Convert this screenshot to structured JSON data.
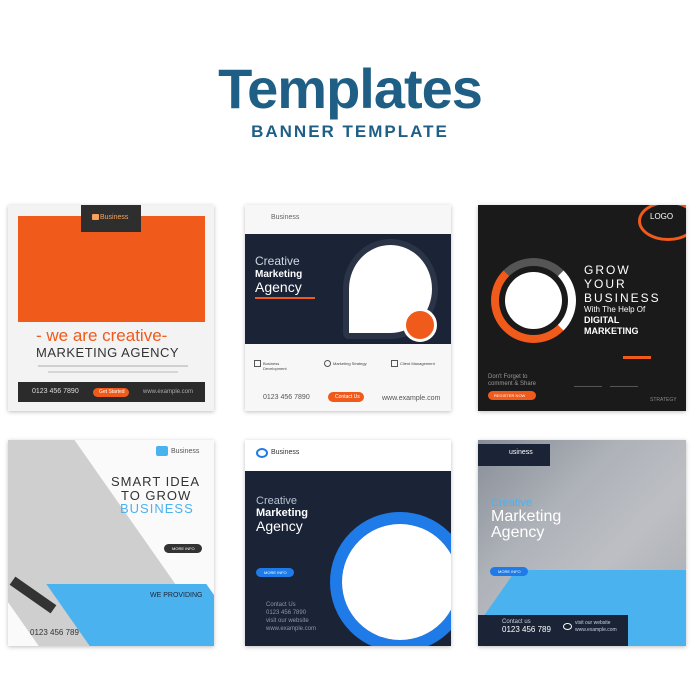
{
  "header": {
    "title": "Templates",
    "subtitle": "BANNER TEMPLATE"
  },
  "colors": {
    "primary": "#1f5f86",
    "orange": "#f05a1a",
    "navy": "#1b2436",
    "blue": "#1e7be8",
    "sky": "#4bb2f0"
  },
  "cards": {
    "c1": {
      "badge": "Business",
      "headline": "- we are creative-",
      "subhead": "MARKETING AGENCY",
      "phone": "0123 456 7890",
      "button": "Get Started",
      "site": "www.example.com"
    },
    "c2": {
      "brand": "Business",
      "line1": "Creative",
      "line2": "Marketing",
      "line3": "Agency",
      "features": [
        "Business Development",
        "Marketing Strategy",
        "Client Management"
      ],
      "phone": "0123 456 7890",
      "button": "Contact Us",
      "site": "www.example.com"
    },
    "c3": {
      "logo": "LOGO",
      "line1": "GROW",
      "line2": "YOUR",
      "line3": "BUSINESS",
      "line4": "With The Help Of",
      "line5": "DIGITAL",
      "line6": "MARKETING",
      "note1": "Don't Forget to",
      "note2": "comment & Share",
      "button": "REGISTER NOW",
      "extra": "STRATEGY"
    },
    "c4": {
      "brand": "Business",
      "line1": "SMART IDEA",
      "line2": "TO GROW",
      "line3": "BUSINESS",
      "button": "MORE INFO",
      "providing": "WE PROVIDING",
      "phone": "0123 456 789"
    },
    "c5": {
      "brand": "Business",
      "line1": "Creative",
      "line2": "Marketing",
      "line3": "Agency",
      "button": "MORE INFO",
      "contact": "Contact Us",
      "phone": "0123 456 7890",
      "web1": "visit our website",
      "site": "www.example.com"
    },
    "c6": {
      "brand": "usiness",
      "line1": "Creative",
      "line2": "Marketing",
      "line3": "Agency",
      "button": "MORE INFO",
      "contact": "Contact us",
      "phone": "0123 456 789",
      "web1": "visit our website",
      "site": "www.example.com"
    }
  }
}
